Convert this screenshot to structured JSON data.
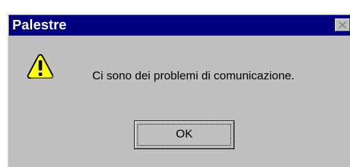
{
  "dialog": {
    "title": "Palestre",
    "message": "Ci sono dei problemi di comunicazione.",
    "ok_label": "OK",
    "close_icon": "close-icon",
    "message_icon": "warning-icon"
  },
  "colors": {
    "titlebar": "#000080",
    "face": "#c0c0c0",
    "warning_fill": "#ffff00"
  }
}
